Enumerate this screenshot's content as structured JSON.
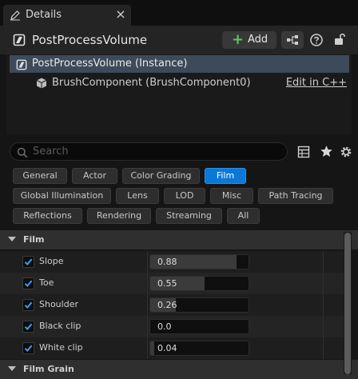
{
  "tab": {
    "title": "Details",
    "close": "×"
  },
  "header": {
    "actor_name": "PostProcessVolume",
    "add_label": "Add",
    "add_plus": "+"
  },
  "tree": {
    "instance_label": "PostProcessVolume (Instance)",
    "component_label": "BrushComponent (BrushComponent0)",
    "edit_link": "Edit in C++"
  },
  "search": {
    "placeholder": "Search"
  },
  "categories": [
    {
      "label": "General",
      "active": false
    },
    {
      "label": "Actor",
      "active": false
    },
    {
      "label": "Color Grading",
      "active": false
    },
    {
      "label": "Film",
      "active": true
    },
    {
      "label": "Global Illumination",
      "active": false
    },
    {
      "label": "Lens",
      "active": false
    },
    {
      "label": "LOD",
      "active": false
    },
    {
      "label": "Misc",
      "active": false
    },
    {
      "label": "Path Tracing",
      "active": false
    },
    {
      "label": "Reflections",
      "active": false
    },
    {
      "label": "Rendering",
      "active": false
    },
    {
      "label": "Streaming",
      "active": false
    },
    {
      "label": "All",
      "active": false
    }
  ],
  "sections": {
    "film": "Film",
    "film_grain": "Film Grain"
  },
  "properties": [
    {
      "label": "Slope",
      "value": "0.88",
      "fill": 0.88,
      "checked": true
    },
    {
      "label": "Toe",
      "value": "0.55",
      "fill": 0.55,
      "checked": true
    },
    {
      "label": "Shoulder",
      "value": "0.26",
      "fill": 0.26,
      "checked": true
    },
    {
      "label": "Black clip",
      "value": "0.0",
      "fill": 0.0,
      "checked": true
    },
    {
      "label": "White clip",
      "value": "0.04",
      "fill": 0.04,
      "checked": true
    }
  ],
  "colors": {
    "accent": "#0a78d6",
    "selection": "#3d4a5a",
    "add_green": "#5cc85c",
    "check_blue": "#3e9cf0"
  }
}
